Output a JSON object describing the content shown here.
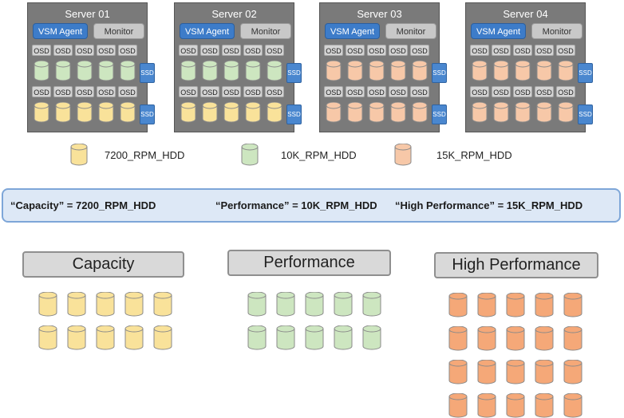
{
  "colors": {
    "7200_RPM_HDD": "#f9e29a",
    "10K_RPM_HDD": "#cde6c0",
    "15K_RPM_HDD": "#f7c8a8",
    "pool_high_performance": "#f5a878",
    "server_bg": "#7a7a7a",
    "vsm_agent": "#3d7cc9",
    "ssd": "#4a87cf"
  },
  "servers": [
    {
      "title": "Server 01",
      "agent_label": "VSM Agent",
      "monitor_label": "Monitor",
      "osd_label": "OSD",
      "ssd_label": "SSD",
      "row_types": [
        "10K_RPM_HDD",
        "7200_RPM_HDD"
      ]
    },
    {
      "title": "Server 02",
      "agent_label": "VSM Agent",
      "monitor_label": "Monitor",
      "osd_label": "OSD",
      "ssd_label": "SSD",
      "row_types": [
        "10K_RPM_HDD",
        "7200_RPM_HDD"
      ]
    },
    {
      "title": "Server 03",
      "agent_label": "VSM Agent",
      "monitor_label": "Monitor",
      "osd_label": "OSD",
      "ssd_label": "SSD",
      "row_types": [
        "15K_RPM_HDD",
        "15K_RPM_HDD"
      ]
    },
    {
      "title": "Server 04",
      "agent_label": "VSM Agent",
      "monitor_label": "Monitor",
      "osd_label": "OSD",
      "ssd_label": "SSD",
      "row_types": [
        "15K_RPM_HDD",
        "15K_RPM_HDD"
      ]
    }
  ],
  "legend": [
    {
      "type": "7200_RPM_HDD",
      "label": "7200_RPM_HDD"
    },
    {
      "type": "10K_RPM_HDD",
      "label": "10K_RPM_HDD"
    },
    {
      "type": "15K_RPM_HDD",
      "label": "15K_RPM_HDD"
    }
  ],
  "mapping": [
    "“Capacity” = 7200_RPM_HDD",
    "“Performance” = 10K_RPM_HDD",
    "“High Performance” = 15K_RPM_HDD"
  ],
  "pools": [
    {
      "title": "Capacity",
      "type": "7200_RPM_HDD",
      "rows": 2,
      "cols": 5
    },
    {
      "title": "Performance",
      "type": "10K_RPM_HDD",
      "rows": 2,
      "cols": 5
    },
    {
      "title": "High Performance",
      "type": "pool_high_performance",
      "rows": 4,
      "cols": 5
    }
  ]
}
